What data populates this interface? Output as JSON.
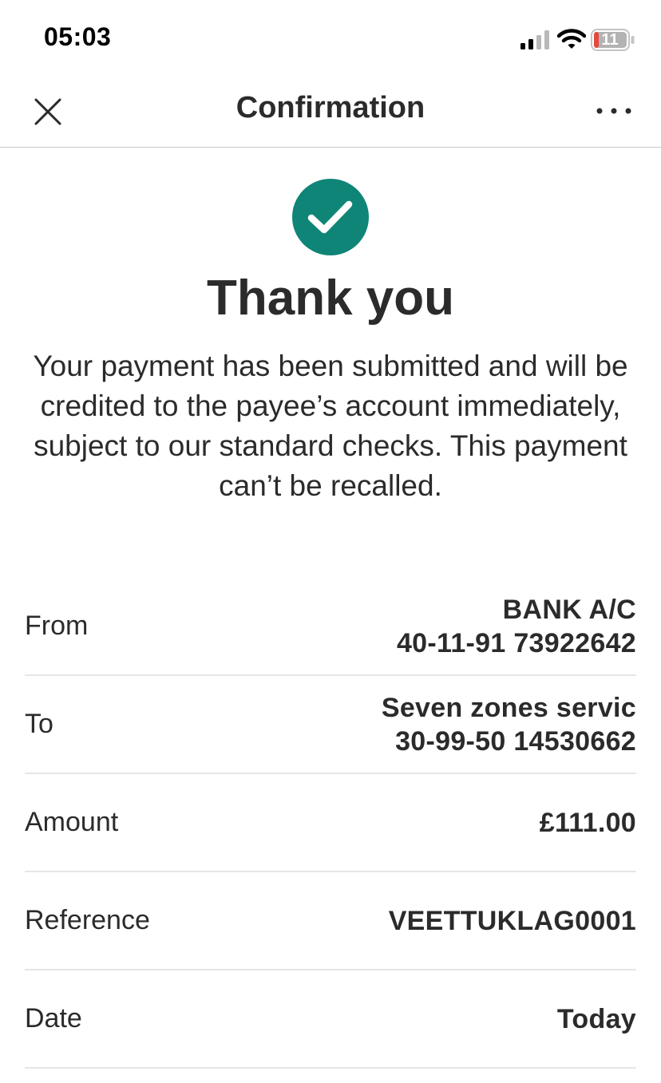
{
  "status_bar": {
    "time": "05:03",
    "battery_level": "11",
    "icons": [
      "signal-icon",
      "wifi-icon",
      "battery-icon"
    ]
  },
  "nav": {
    "title": "Confirmation",
    "left_icon": "close-icon",
    "right_icon": "more-icon"
  },
  "confirmation": {
    "icon": "check-circle-icon",
    "headline": "Thank you",
    "message": "Your payment has been submitted and will be credited to the payee’s account immediately, subject to our standard checks. This payment can’t be recalled."
  },
  "details": {
    "from": {
      "label": "From",
      "line1": "BANK A/C",
      "line2": "40-11-91 73922642"
    },
    "to": {
      "label": "To",
      "line1": "Seven zones servic",
      "line2": "30-99-50 14530662"
    },
    "amount": {
      "label": "Amount",
      "value": "£111.00"
    },
    "reference": {
      "label": "Reference",
      "value": "VEETTUKLAG0001"
    },
    "date": {
      "label": "Date",
      "value": "Today"
    }
  },
  "colors": {
    "accent": "#0e8577",
    "text": "#2b2b2b",
    "divider": "#e6e6e6",
    "battery_low": "#e5483d"
  }
}
